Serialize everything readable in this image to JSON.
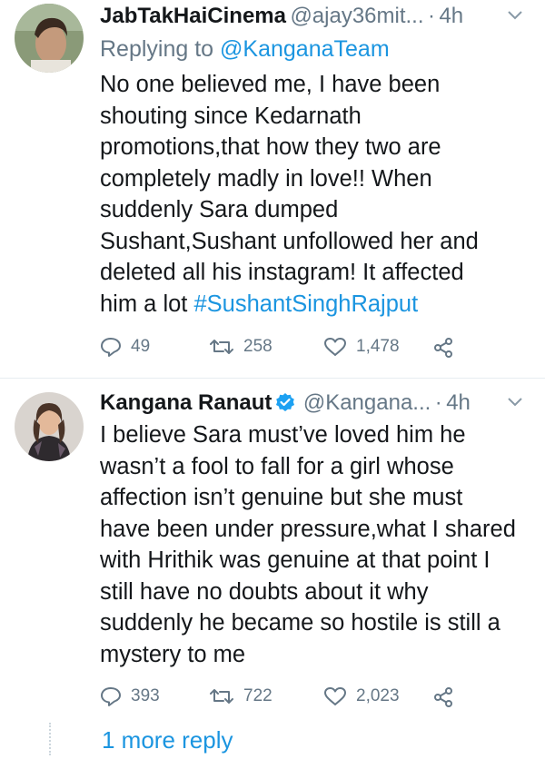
{
  "tweets": [
    {
      "name": "JabTakHaiCinema",
      "handle": "@ajay36mit...",
      "dot": "·",
      "time": "4h",
      "reply_prefix": "Replying to ",
      "reply_to": "@KanganaTeam",
      "lines": [
        "No one believed me, I have been",
        "shouting since Kedarnath",
        "promotions,that how they two are",
        "completely madly in love!! When",
        "suddenly Sara dumped",
        "Sushant,Sushant unfollowed her and",
        "deleted all his instagram! It affected",
        "him a lot "
      ],
      "hashtag": "#SushantSinghRajput",
      "replies": "49",
      "retweets": "258",
      "likes": "1,478"
    },
    {
      "name": "Kangana Ranaut",
      "handle": "@Kangana...",
      "dot": "·",
      "time": "4h",
      "lines": [
        "I believe Sara must’ve loved him he",
        "wasn’t a fool to fall for a girl whose",
        "affection isn’t genuine but she must",
        "have been under pressure,what I shared",
        "with Hrithik was genuine at that point I",
        "still have no doubts about it why",
        "suddenly he became so hostile is still a",
        "mystery to me"
      ],
      "replies": "393",
      "retweets": "722",
      "likes": "2,023"
    }
  ],
  "more_replies": "1 more reply",
  "icons": {
    "reply": "reply-icon",
    "retweet": "retweet-icon",
    "like": "heart-icon",
    "share": "share-icon",
    "caret": "chevron-down-icon",
    "verified": "verified-badge-icon"
  },
  "colors": {
    "accent": "#1b95e0",
    "muted": "#657786",
    "text": "#14171a",
    "verified": "#1da1f2"
  }
}
